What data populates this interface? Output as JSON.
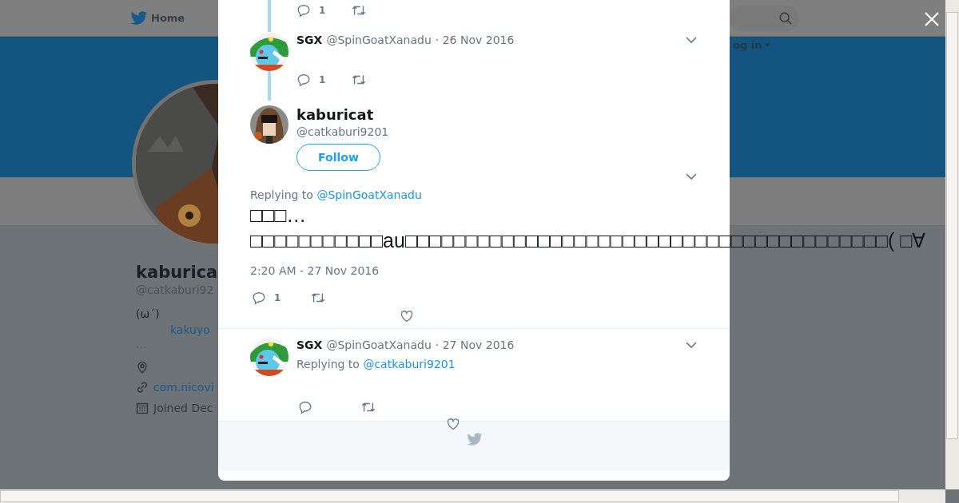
{
  "top_nav": {
    "home": "Home",
    "login": "og in"
  },
  "profile": {
    "name": "kaburica",
    "handle": "@catkaburi92",
    "bio": "(ω´)",
    "bio_link": "kakuyo",
    "more": "...",
    "website": "com.nicovi",
    "joined": "Joined Dec"
  },
  "previous_tweet": {
    "reply_count": "1"
  },
  "parent_tweet": {
    "name": "SGX",
    "handle": "@SpinGoatXanadu",
    "date": "· 26 Nov 2016",
    "reply_count": "1"
  },
  "main_tweet": {
    "name": "kaburicat",
    "handle": "@catkaburi9201",
    "follow": "Follow",
    "replying_label": "Replying to",
    "replying_to": "@SpinGoatXanadu",
    "text_lines": [
      "□□□…",
      "□□□□□□□□□□□au□□□□□□□□□□□□□□□□□□□□□□□□□□□□□□□□□□□□□□□□(  □∀"
    ],
    "timestamp": "2:20 AM - 27 Nov 2016",
    "reply_count": "1"
  },
  "reply_tweet": {
    "name": "SGX",
    "handle": "@SpinGoatXanadu",
    "date": "· 27 Nov 2016",
    "replying_label": "Replying to",
    "replying_to": "@catkaburi9201"
  }
}
